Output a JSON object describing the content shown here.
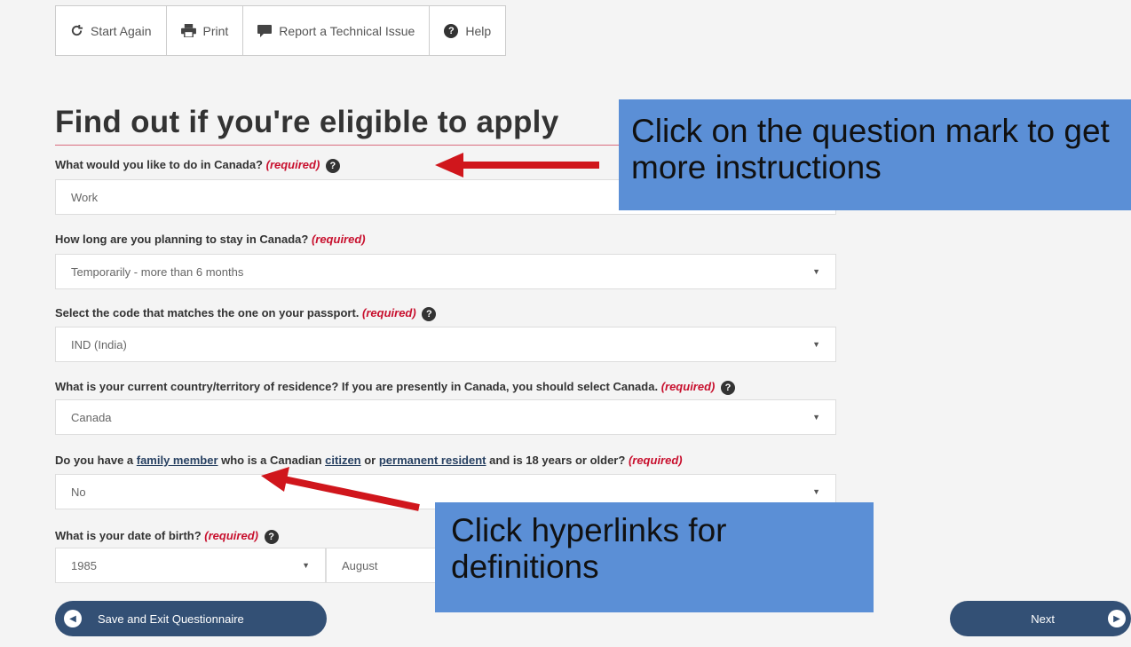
{
  "toolbar": {
    "start_again": "Start Again",
    "print": "Print",
    "report": "Report a Technical Issue",
    "help": "Help"
  },
  "title": "Find out if you're eligible to apply",
  "questions": {
    "q1": {
      "label": "What would you like to do in Canada?",
      "required": "(required)",
      "value": "Work"
    },
    "q2": {
      "label": "How long are you planning to stay in Canada?",
      "required": "(required)",
      "value": "Temporarily - more than 6 months"
    },
    "q3": {
      "label": "Select the code that matches the one on your passport.",
      "required": "(required)",
      "value": "IND (India)"
    },
    "q4": {
      "label": "What is your current country/territory of residence? If you are presently in Canada, you should select Canada.",
      "required": "(required)",
      "value": "Canada"
    },
    "q5": {
      "prefix": "Do you have a ",
      "link1": "family member",
      "mid1": " who is a Canadian ",
      "link2": "citizen",
      "mid2": " or ",
      "link3": "permanent resident",
      "suffix": " and is 18 years or older?",
      "required": "(required)",
      "value": "No"
    },
    "q6": {
      "label": "What is your date of birth?",
      "required": "(required)",
      "year": "1985",
      "month": "August"
    }
  },
  "buttons": {
    "save_exit": "Save and Exit Questionnaire",
    "next": "Next"
  },
  "annotations": {
    "top": "Click on the question mark to get more instructions",
    "bottom": "Click hyperlinks for definitions"
  },
  "colors": {
    "required": "#c8102e",
    "button_bg": "#335075",
    "callout_bg": "#5b8fd6",
    "arrow": "#d0161c"
  }
}
